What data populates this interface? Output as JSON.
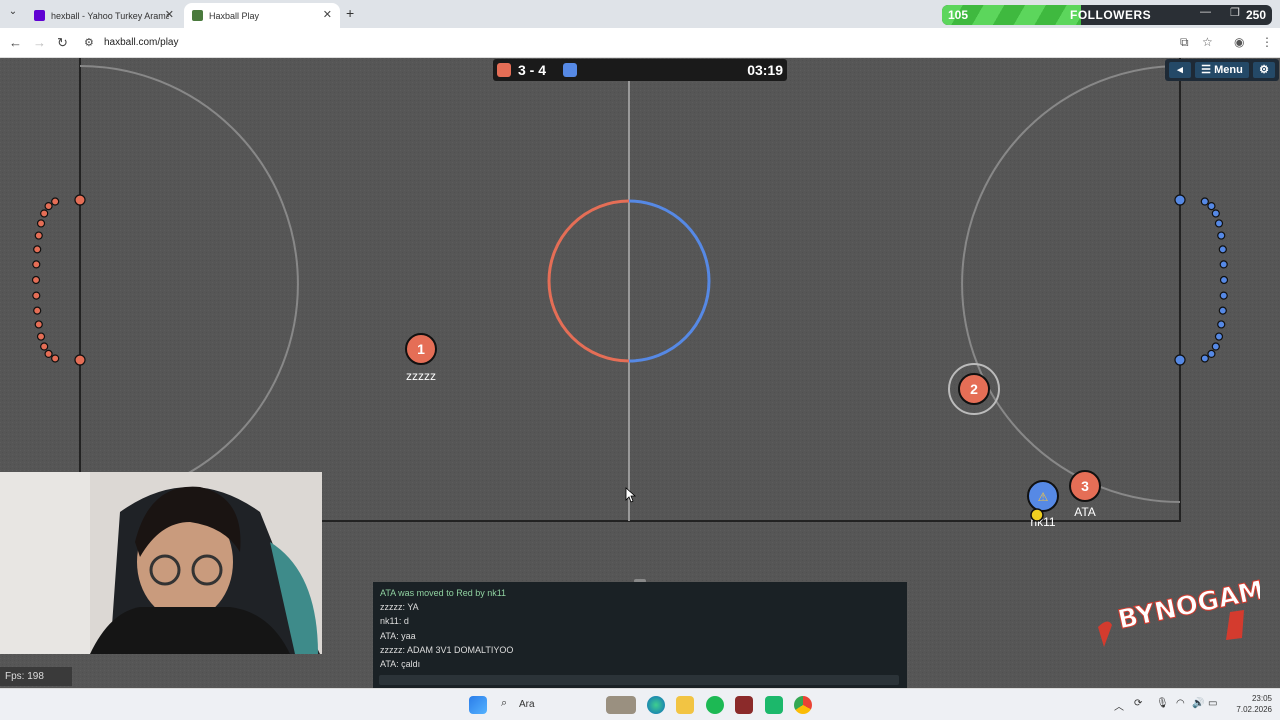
{
  "browser": {
    "tabs": [
      {
        "title": "hexball - Yahoo Turkey Arama S",
        "favicon_color": "#6001d2",
        "active": false
      },
      {
        "title": "Haxball Play",
        "favicon_color": "#4a7a3d",
        "active": true
      }
    ],
    "url": "haxball.com/play"
  },
  "overlay": {
    "followers_current": "105",
    "followers_label": "FOLLOWERS",
    "followers_goal": "250",
    "followers_progress_fraction": 0.42
  },
  "game": {
    "score": "3 - 4",
    "timer": "03:19",
    "menu_label": "Menu",
    "red_color": "#e56e56",
    "blue_color": "#5689e5",
    "players": [
      {
        "number": "1",
        "name": "zzzzz",
        "team": "red"
      },
      {
        "number": "2",
        "name": "",
        "team": "red"
      },
      {
        "number": "3",
        "name": "ATA",
        "team": "red"
      },
      {
        "number": "⚠",
        "name": "nk11",
        "team": "blue"
      }
    ]
  },
  "chat": {
    "messages": [
      {
        "text": "ATA was moved to Red by nk11",
        "system": true
      },
      {
        "text": "zzzzz: YA",
        "system": false
      },
      {
        "text": "nk11: d",
        "system": false
      },
      {
        "text": "ATA: yaa",
        "system": false
      },
      {
        "text": "zzzzz: ADAM 3V1 DOMALTIYOO",
        "system": false
      },
      {
        "text": "ATA: çaldı",
        "system": false
      }
    ]
  },
  "fps": "Fps: 198",
  "logo_text": "BYNOGAM",
  "taskbar": {
    "search_label": "Ara",
    "time": "23:05",
    "date": "7.02.2026"
  }
}
